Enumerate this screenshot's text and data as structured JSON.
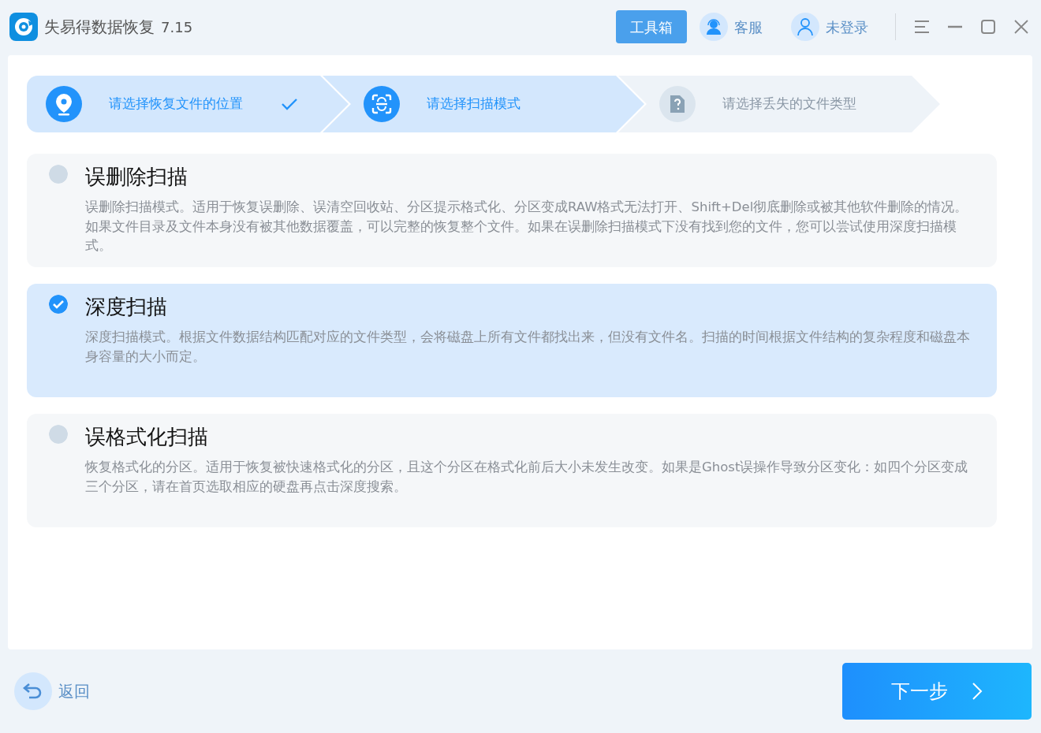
{
  "app": {
    "title": "失易得数据恢复",
    "version": "7.15"
  },
  "header": {
    "toolbox_button": "工具箱",
    "support": "客服",
    "account": "未登录"
  },
  "steps": [
    {
      "label": "请选择恢复文件的位置",
      "kind": "done"
    },
    {
      "label": "请选择扫描模式",
      "kind": "current"
    },
    {
      "label": "请选择丢失的文件类型",
      "kind": "pending"
    }
  ],
  "scan_modes": [
    {
      "title": "误删除扫描",
      "description": "误删除扫描模式。适用于恢复误删除、误清空回收站、分区提示格式化、分区变成RAW格式无法打开、Shift+Del彻底删除或被其他软件删除的情况。如果文件目录及文件本身没有被其他数据覆盖，可以完整的恢复整个文件。如果在误删除扫描模式下没有找到您的文件，您可以尝试使用深度扫描模式。",
      "selected": false
    },
    {
      "title": "深度扫描",
      "description": "深度扫描模式。根据文件数据结构匹配对应的文件类型，会将磁盘上所有文件都找出来，但没有文件名。扫描的时间根据文件结构的复杂程度和磁盘本身容量的大小而定。",
      "selected": true
    },
    {
      "title": "误格式化扫描",
      "description": "恢复格式化的分区。适用于恢复被快速格式化的分区，且这个分区在格式化前后大小未发生改变。如果是Ghost误操作导致分区变化：如四个分区变成三个分区，请在首页选取相应的硬盘再点击深度搜索。",
      "selected": false
    }
  ],
  "footer": {
    "back": "返回",
    "next": "下一步"
  }
}
